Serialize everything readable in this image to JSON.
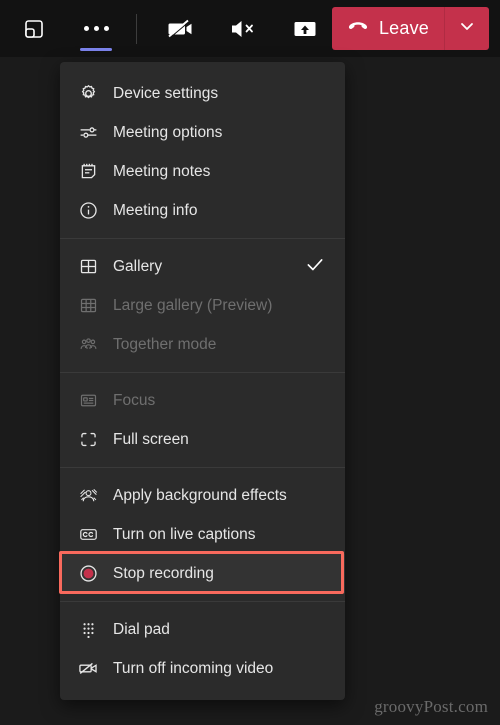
{
  "toolbar": {
    "buttons": [
      {
        "name": "popout-button",
        "icon": "popout-icon",
        "label": "Pop out"
      },
      {
        "name": "more-actions-button",
        "icon": "more-horizontal-icon",
        "label": "More actions",
        "active": true
      },
      {
        "name": "camera-button",
        "icon": "camera-off-icon",
        "label": "Turn camera on"
      },
      {
        "name": "speaker-button",
        "icon": "speaker-mute-icon",
        "label": "Unmute"
      },
      {
        "name": "share-button",
        "icon": "share-screen-icon",
        "label": "Share content"
      }
    ],
    "leave": {
      "label": "Leave",
      "icon": "hangup-icon",
      "caret_icon": "chevron-down-icon",
      "color": "#c4314b"
    }
  },
  "menu": {
    "background": "#2b2b2b",
    "highlight_color": "#f96a5d",
    "sections": [
      {
        "items": [
          {
            "label": "Device settings",
            "icon": "gear-icon",
            "disabled": false,
            "checked": false
          },
          {
            "label": "Meeting options",
            "icon": "sliders-icon",
            "disabled": false,
            "checked": false
          },
          {
            "label": "Meeting notes",
            "icon": "notes-icon",
            "disabled": false,
            "checked": false
          },
          {
            "label": "Meeting info",
            "icon": "info-icon",
            "disabled": false,
            "checked": false
          }
        ]
      },
      {
        "items": [
          {
            "label": "Gallery",
            "icon": "gallery-icon",
            "disabled": false,
            "checked": true
          },
          {
            "label": "Large gallery (Preview)",
            "icon": "large-gallery-icon",
            "disabled": true,
            "checked": false
          },
          {
            "label": "Together mode",
            "icon": "together-mode-icon",
            "disabled": true,
            "checked": false
          }
        ]
      },
      {
        "items": [
          {
            "label": "Focus",
            "icon": "focus-icon",
            "disabled": true,
            "checked": false
          },
          {
            "label": "Full screen",
            "icon": "full-screen-icon",
            "disabled": false,
            "checked": false
          }
        ]
      },
      {
        "items": [
          {
            "label": "Apply background effects",
            "icon": "background-effects-icon",
            "disabled": false,
            "checked": false
          },
          {
            "label": "Turn on live captions",
            "icon": "closed-captions-icon",
            "disabled": false,
            "checked": false
          },
          {
            "label": "Stop recording",
            "icon": "record-icon",
            "disabled": false,
            "checked": false,
            "highlighted": true
          }
        ]
      },
      {
        "items": [
          {
            "label": "Dial pad",
            "icon": "dial-pad-icon",
            "disabled": false,
            "checked": false
          },
          {
            "label": "Turn off incoming video",
            "icon": "incoming-video-off-icon",
            "disabled": false,
            "checked": false
          }
        ]
      }
    ]
  },
  "watermark": {
    "text": "groovyPost.com"
  }
}
